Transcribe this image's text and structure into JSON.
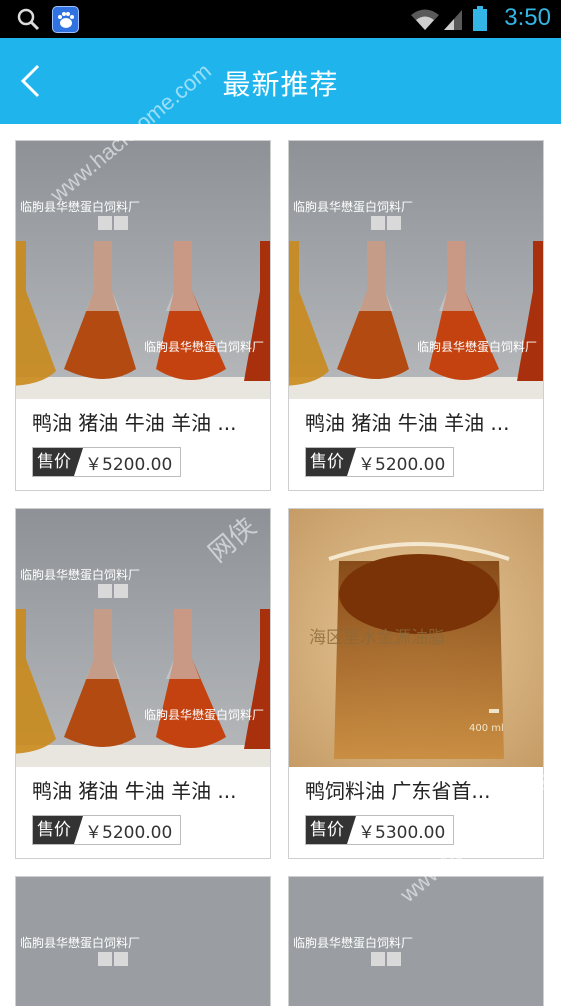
{
  "status_bar": {
    "time": "3:50",
    "icons": [
      "search-icon",
      "baidu-icon",
      "wifi-icon",
      "signal-icon",
      "battery-icon"
    ]
  },
  "header": {
    "title": "最新推荐",
    "back_icon": "chevron-left-icon"
  },
  "colors": {
    "appbar": "#1fb5ec",
    "status_text": "#33b5e5",
    "price_tag_bg": "#333333"
  },
  "products": [
    {
      "name": "鸭油 猪油 牛油 羊油 ...",
      "price_label": "售价",
      "price": "￥5200.00",
      "image_caption": "临朐县华懋蛋白饲料厂"
    },
    {
      "name": "鸭油 猪油 牛油 羊油 ...",
      "price_label": "售价",
      "price": "￥5200.00",
      "image_caption": "临朐县华懋蛋白饲料厂"
    },
    {
      "name": "鸭油 猪油 牛油 羊油 ...",
      "price_label": "售价",
      "price": "￥5200.00",
      "image_caption": "临朐县华懋蛋白饲料厂"
    },
    {
      "name": "鸭饲料油 广东省首...",
      "price_label": "售价",
      "price": "￥5300.00",
      "image_caption": "海区里水金源油脂"
    },
    {
      "image_caption": "临朐县华懋蛋白饲料厂"
    },
    {
      "image_caption": "临朐县华懋蛋白饲料厂"
    }
  ],
  "watermarks": [
    "www.hackhome.com",
    "网侠"
  ]
}
